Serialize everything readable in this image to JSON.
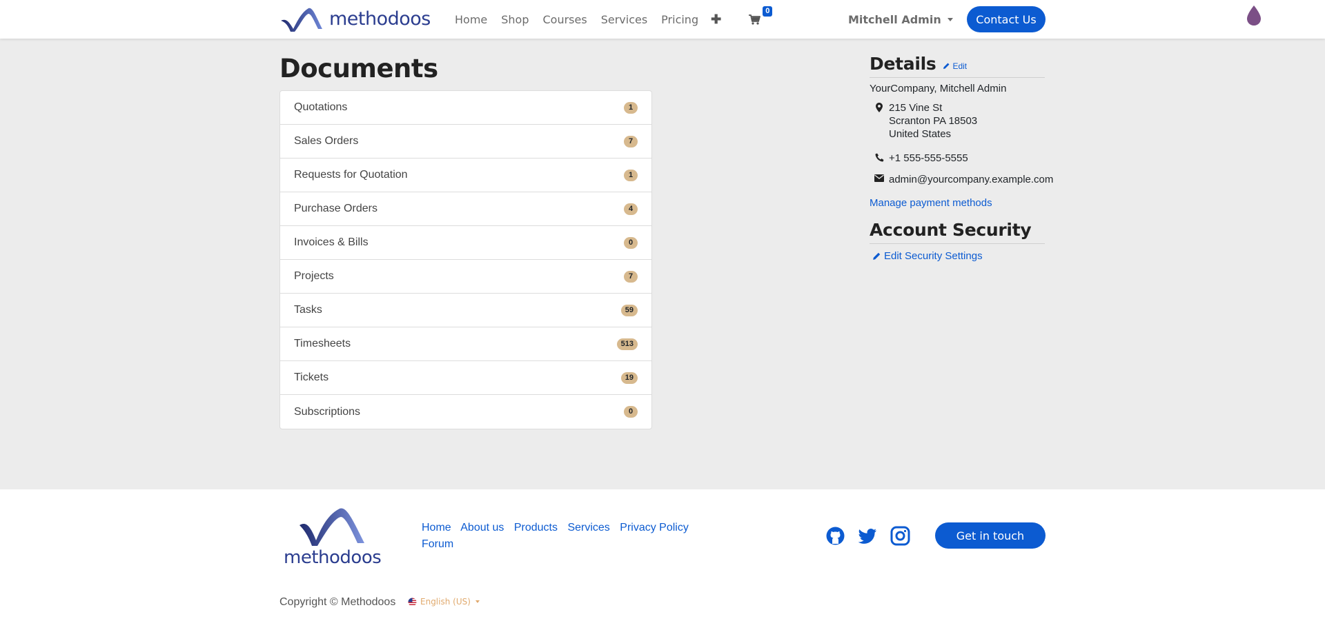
{
  "header": {
    "logo_text": "methodoos",
    "nav": [
      "Home",
      "Shop",
      "Courses",
      "Services",
      "Pricing"
    ],
    "cart_count": "0",
    "user_name": "Mitchell Admin",
    "contact_label": "Contact Us"
  },
  "documents": {
    "title": "Documents",
    "items": [
      {
        "label": "Quotations",
        "count": "1"
      },
      {
        "label": "Sales Orders",
        "count": "7"
      },
      {
        "label": "Requests for Quotation",
        "count": "1"
      },
      {
        "label": "Purchase Orders",
        "count": "4"
      },
      {
        "label": "Invoices & Bills",
        "count": "0"
      },
      {
        "label": "Projects",
        "count": "7"
      },
      {
        "label": "Tasks",
        "count": "59"
      },
      {
        "label": "Timesheets",
        "count": "513"
      },
      {
        "label": "Tickets",
        "count": "19"
      },
      {
        "label": "Subscriptions",
        "count": "0"
      }
    ]
  },
  "details": {
    "title": "Details",
    "edit_label": "Edit",
    "company_line": "YourCompany, Mitchell Admin",
    "address": [
      "215 Vine St",
      "Scranton PA 18503",
      "United States"
    ],
    "phone": "+1 555-555-5555",
    "email": "admin@yourcompany.example.com",
    "manage_payment": "Manage payment methods"
  },
  "security": {
    "title": "Account Security",
    "edit_label": "Edit Security Settings"
  },
  "footer": {
    "logo_text": "methodoos",
    "links": [
      "Home",
      "About us",
      "Products",
      "Services",
      "Privacy Policy",
      "Forum"
    ],
    "social_icons": [
      "github-icon",
      "twitter-icon",
      "instagram-icon"
    ],
    "cta_label": "Get in touch",
    "copyright": "Copyright © Methodoos",
    "language": "English (US)"
  },
  "colors": {
    "primary": "#0c5bd1",
    "badge": "#d7b98e",
    "brand": "#2b3d8f",
    "background": "#ececec"
  }
}
